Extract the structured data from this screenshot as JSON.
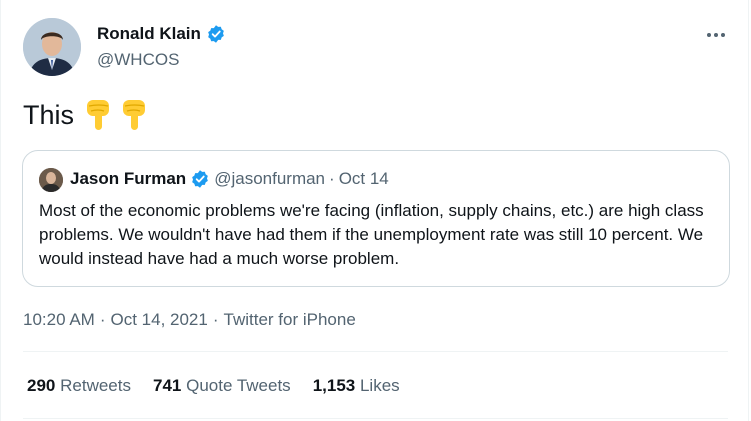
{
  "author": {
    "name": "Ronald Klain",
    "handle": "@WHCOS",
    "avatar_icon": "avatar-photo-icon",
    "verified_icon": "verified-badge-icon",
    "verified_color": "#1d9bf0"
  },
  "tweet": {
    "text": "This",
    "emojis": [
      "backhand-index-pointing-down-icon",
      "backhand-index-pointing-down-icon"
    ]
  },
  "quote": {
    "name": "Jason Furman",
    "handle": "@jasonfurman",
    "separator": "·",
    "date": "Oct 14",
    "text": "Most of the economic problems we're facing (inflation, supply chains, etc.) are high class problems. We wouldn't have had them if the unemployment rate was still 10 percent. We would instead have had a much worse problem."
  },
  "meta": {
    "time": "10:20 AM",
    "sep1": "·",
    "date": "Oct 14, 2021",
    "sep2": "·",
    "source": "Twitter for iPhone"
  },
  "stats": {
    "retweets_count": "290",
    "retweets_label": "Retweets",
    "quotes_count": "741",
    "quotes_label": "Quote Tweets",
    "likes_count": "1,153",
    "likes_label": "Likes"
  },
  "colors": {
    "text": "#0f1419",
    "secondary": "#536471",
    "border": "#cfd9de",
    "verified": "#1d9bf0",
    "emoji": "#ffcc33"
  }
}
